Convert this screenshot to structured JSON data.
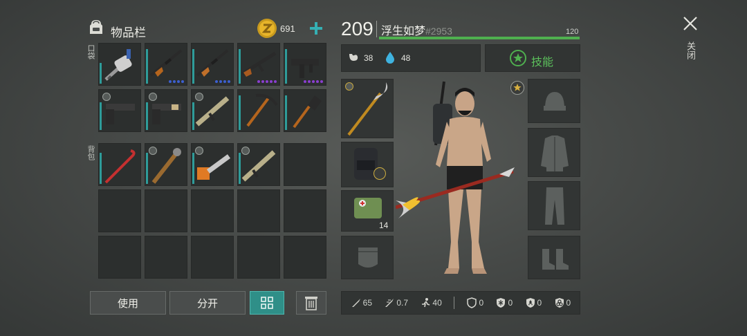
{
  "inventory": {
    "title": "物品栏",
    "coins": "691",
    "pocket_label": "口袋",
    "backpack_label": "背包"
  },
  "player": {
    "level": "209",
    "name": "浮生如梦",
    "tag": "#2953",
    "hp_max": "120",
    "hp_fraction": 1.0,
    "food": "38",
    "water": "48"
  },
  "skills_label": "技能",
  "item_counts": {
    "medkit": "14"
  },
  "actions": {
    "use": "使用",
    "split": "分开"
  },
  "close_label": "关闭",
  "stats": {
    "attack": "65",
    "attack_speed": "0.7",
    "speed": "40",
    "armor": "0",
    "cold": "0",
    "radiation": "0",
    "poison": "0"
  },
  "colors": {
    "accent": "#4fb04f",
    "durability": "#2e9c9a",
    "sort_button": "#2f8f88"
  }
}
